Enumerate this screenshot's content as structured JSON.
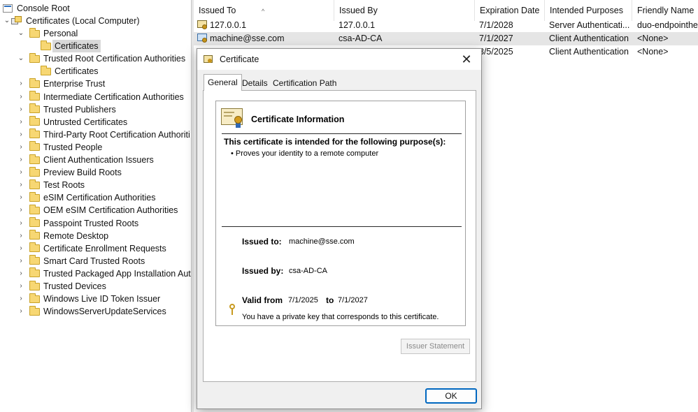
{
  "tree": {
    "root": "Console Root",
    "computer": "Certificates (Local Computer)",
    "items": [
      {
        "label": "Personal",
        "expanded": true
      },
      {
        "label": "Certificates",
        "selected": true
      },
      {
        "label": "Trusted Root Certification Authorities",
        "expanded": true
      },
      {
        "label": "Certificates"
      },
      {
        "label": "Enterprise Trust"
      },
      {
        "label": "Intermediate Certification Authorities"
      },
      {
        "label": "Trusted Publishers"
      },
      {
        "label": "Untrusted Certificates"
      },
      {
        "label": "Third-Party Root Certification Authoriti"
      },
      {
        "label": "Trusted People"
      },
      {
        "label": "Client Authentication Issuers"
      },
      {
        "label": "Preview Build Roots"
      },
      {
        "label": "Test Roots"
      },
      {
        "label": "eSIM Certification Authorities"
      },
      {
        "label": "OEM eSIM Certification Authorities"
      },
      {
        "label": "Passpoint Trusted Roots"
      },
      {
        "label": "Remote Desktop"
      },
      {
        "label": "Certificate Enrollment Requests"
      },
      {
        "label": "Smart Card Trusted Roots"
      },
      {
        "label": "Trusted Packaged App Installation Auth"
      },
      {
        "label": "Trusted Devices"
      },
      {
        "label": "Windows Live ID Token Issuer"
      },
      {
        "label": "WindowsServerUpdateServices"
      }
    ]
  },
  "list": {
    "columns": [
      "Issued To",
      "Issued By",
      "Expiration Date",
      "Intended Purposes",
      "Friendly Name"
    ],
    "sort_arrow": "^",
    "rows": [
      {
        "issued_to": "127.0.0.1",
        "issued_by": "127.0.0.1",
        "expiration": "7/1/2028",
        "purposes": "Server Authenticati...",
        "friendly": "duo-endpointhe"
      },
      {
        "issued_to": "machine@sse.com",
        "issued_by": "csa-AD-CA",
        "expiration": "7/1/2027",
        "purposes": "Client Authentication",
        "friendly": "<None>",
        "selected": true
      },
      {
        "issued_to": "",
        "issued_by": "",
        "expiration": "3/5/2025",
        "purposes": "Client Authentication",
        "friendly": "<None>"
      }
    ]
  },
  "dialog": {
    "title": "Certificate",
    "close": "✕",
    "tabs": [
      "General",
      "Details",
      "Certification Path"
    ],
    "active_tab": "General",
    "info_title": "Certificate Information",
    "purpose_heading": "This certificate is intended for the following purpose(s):",
    "purposes": [
      "• Proves your identity to a remote computer"
    ],
    "issued_to_label": "Issued to:",
    "issued_to": "machine@sse.com",
    "issued_by_label": "Issued by:",
    "issued_by": "csa-AD-CA",
    "valid_from_label": "Valid from",
    "valid_from": "7/1/2025",
    "to_label": "to",
    "valid_to": "7/1/2027",
    "private_key_note": "You have a private key that corresponds to this certificate.",
    "issuer_statement": "Issuer Statement",
    "ok": "OK"
  },
  "colors": {
    "accent": "#0067c0",
    "selection": "#e5e5e5",
    "folder": "#f7d773"
  }
}
